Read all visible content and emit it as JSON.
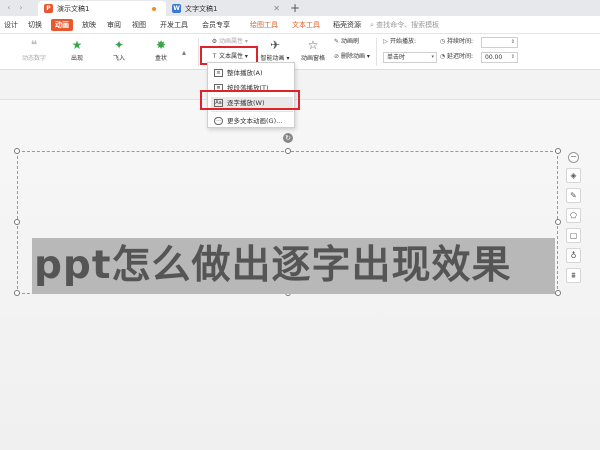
{
  "tabs": [
    {
      "title": "演示文稿1",
      "active": true,
      "icon": "P",
      "color": "#e9572e"
    },
    {
      "title": "文字文稿1",
      "active": false,
      "icon": "W",
      "color": "#3a78d8"
    }
  ],
  "menu": {
    "items": [
      "设计",
      "切换",
      "动画",
      "放映",
      "审阅",
      "视图",
      "开发工具",
      "会员专享",
      "绘图工具",
      "文本工具",
      "稻壳资源"
    ],
    "active": "动画",
    "search_placeholder": "查找命令、搜索模板"
  },
  "ribbon": {
    "anim_digits": "动态数字",
    "appear": "出现",
    "fly_in": "飞入",
    "box": "盒状",
    "anim_props": "动画属性",
    "text_props": "文本属性",
    "smart_anim": "智能动画",
    "anim_pane": "动画窗格",
    "anim_brush": "动画刷",
    "delete_anim": "删除动画",
    "start_play": "开始播放:",
    "start_value": "单击时",
    "duration": "持续时间:",
    "delay": "延迟时间:",
    "delay_value": "00.00"
  },
  "dropdown": {
    "items": [
      "整体播放(A)",
      "按段落播放(T)",
      "逐字播放(W)",
      "更多文本动画(G)..."
    ],
    "selected": "逐字播放(W)"
  },
  "slide": {
    "headline": "ppt怎么做出逐字出现效果"
  },
  "colors": {
    "accent": "#e9572e",
    "highlight": "#e0232b",
    "text_tool": "#e0602a"
  }
}
